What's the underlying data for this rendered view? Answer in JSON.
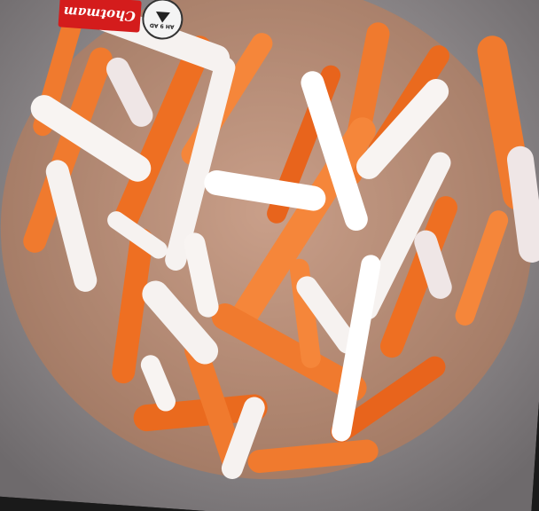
{
  "image": {
    "subject": "pickled-carrot-daikon",
    "palette": {
      "background": "#1a1a1a",
      "carrot": "#f07a2e",
      "carrot_dark": "#d85a14",
      "daikon": "#f6f2f0",
      "daikon_shadow": "#e4d6d6",
      "bowl": "#8f8a8c"
    }
  },
  "watermark": {
    "brand_text": "Chotmam",
    "circle_text": "AH 9 AD",
    "icon": "arrow-icon"
  }
}
